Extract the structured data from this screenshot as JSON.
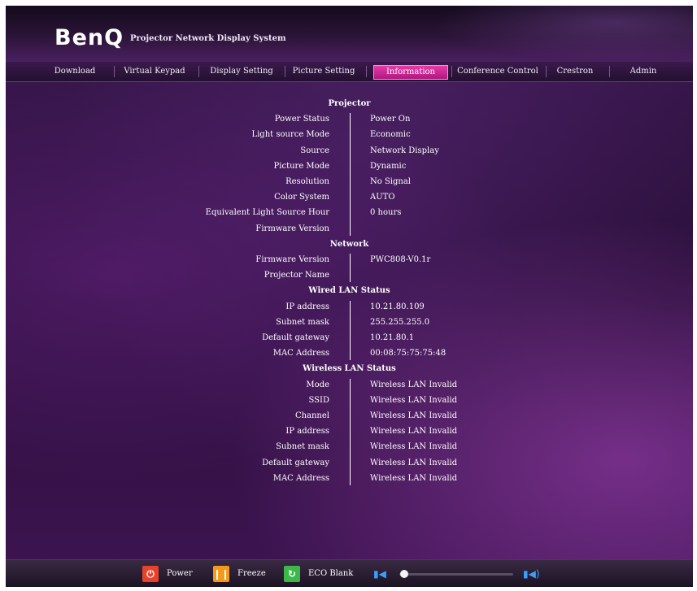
{
  "header": {
    "logo": "BenQ",
    "title": "Projector Network Display System"
  },
  "tabs": [
    {
      "label": "Download",
      "active": false
    },
    {
      "label": "Virtual Keypad",
      "active": false
    },
    {
      "label": "Display Setting",
      "active": false
    },
    {
      "label": "Picture Setting",
      "active": false
    },
    {
      "label": "Information",
      "active": true
    },
    {
      "label": "Conference Control",
      "active": false
    },
    {
      "label": "Crestron",
      "active": false
    },
    {
      "label": "Admin",
      "active": false
    }
  ],
  "sections": [
    {
      "title": "Projector",
      "rows": [
        {
          "label": "Power Status",
          "value": "Power On"
        },
        {
          "label": "Light source Mode",
          "value": "Economic"
        },
        {
          "label": "Source",
          "value": "Network Display"
        },
        {
          "label": "Picture Mode",
          "value": "Dynamic"
        },
        {
          "label": "Resolution",
          "value": "No Signal"
        },
        {
          "label": "Color System",
          "value": "AUTO"
        },
        {
          "label": "Equivalent Light Source Hour",
          "value": "0 hours"
        },
        {
          "label": "Firmware Version",
          "value": ""
        }
      ]
    },
    {
      "title": "Network",
      "rows": [
        {
          "label": "Firmware Version",
          "value": "PWC808-V0.1r"
        },
        {
          "label": "Projector Name",
          "value": ""
        }
      ]
    },
    {
      "title": "Wired LAN Status",
      "rows": [
        {
          "label": "IP address",
          "value": "10.21.80.109"
        },
        {
          "label": "Subnet mask",
          "value": "255.255.255.0"
        },
        {
          "label": "Default gateway",
          "value": "10.21.80.1"
        },
        {
          "label": "MAC Address",
          "value": "00:08:75:75:75:48"
        }
      ]
    },
    {
      "title": "Wireless LAN Status",
      "rows": [
        {
          "label": "Mode",
          "value": "Wireless LAN Invalid"
        },
        {
          "label": "SSID",
          "value": "Wireless LAN Invalid"
        },
        {
          "label": "Channel",
          "value": "Wireless LAN Invalid"
        },
        {
          "label": "IP address",
          "value": "Wireless LAN Invalid"
        },
        {
          "label": "Subnet mask",
          "value": "Wireless LAN Invalid"
        },
        {
          "label": "Default gateway",
          "value": "Wireless LAN Invalid"
        },
        {
          "label": "MAC Address",
          "value": "Wireless LAN Invalid"
        }
      ]
    }
  ],
  "footer": {
    "buttons": [
      {
        "name": "power",
        "label": "Power",
        "icon": "power-icon",
        "color": "#e8432a"
      },
      {
        "name": "freeze",
        "label": "Freeze",
        "icon": "pause-icon",
        "color": "#f39a1c"
      },
      {
        "name": "eco-blank",
        "label": "ECO Blank",
        "icon": "eco-icon",
        "color": "#3cb84a"
      }
    ],
    "volume": {
      "level": 0.04,
      "low_icon": "volume-low-icon",
      "high_icon": "volume-high-icon"
    }
  }
}
